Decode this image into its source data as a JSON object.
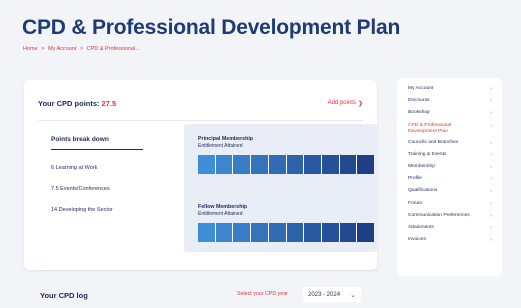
{
  "page": {
    "title": "CPD & Professional Development Plan",
    "breadcrumb": [
      "Home",
      "My Account",
      "CPD & Professional..."
    ],
    "breadcrumb_separator": ">"
  },
  "cpd_card": {
    "points_label": "Your CPD points:",
    "points_value": "27.5",
    "add_points_label": "Add points",
    "breakdown_title": "Points break down",
    "breakdown_items": [
      "6 Learning at Work",
      "7.5 Events/Conferences",
      "14 Developing the Sector"
    ],
    "memberships": [
      {
        "name": "Principal Membership",
        "status": "Entitlement Attained",
        "segments": 10
      },
      {
        "name": "Fellow Membership",
        "status": "Entitlement Attained",
        "segments": 10
      }
    ]
  },
  "cpd_log": {
    "title": "Your CPD log",
    "select_label": "Select your CPD year",
    "selected_year": "2023 - 2024"
  },
  "sidebar": {
    "items": [
      {
        "label": "My Account",
        "active": false
      },
      {
        "label": "Discounts",
        "active": false
      },
      {
        "label": "Bookshop",
        "active": false
      },
      {
        "label": "CPD & Professional Development Plan",
        "active": true
      },
      {
        "label": "Councils and Branches",
        "active": false
      },
      {
        "label": "Training & Events",
        "active": false
      },
      {
        "label": "Membership",
        "active": false
      },
      {
        "label": "Profile",
        "active": false
      },
      {
        "label": "Qualifications",
        "active": false
      },
      {
        "label": "Forum",
        "active": false
      },
      {
        "label": "Communication Preferences",
        "active": false
      },
      {
        "label": "Attainments",
        "active": false
      },
      {
        "label": "Invoices",
        "active": false
      }
    ]
  },
  "colors": {
    "accent": "#e0323b",
    "navy": "#1e2a5a",
    "bar_gradient_start": "#3f8fd8",
    "bar_gradient_end": "#1e3f86"
  }
}
